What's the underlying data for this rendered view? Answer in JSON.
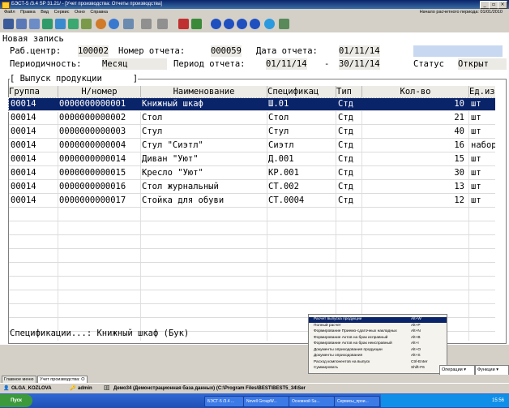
{
  "window": {
    "title": "БЭСТ-5 /3.4 SP 31.21/ - [Учет производства: Отчеты производства]",
    "minimize": "_",
    "restore": "▫",
    "close": "×"
  },
  "menu": {
    "items": [
      "Файл",
      "Правка",
      "Вид",
      "Сервис",
      "Окно",
      "Справка"
    ],
    "period_info": "Начало расчетного периода: 01/01/2010"
  },
  "form": {
    "title": "Новая запись",
    "work_center_label": "Раб.центр:",
    "work_center_value": "100002",
    "report_no_label": "Номер отчета:",
    "report_no_value": "000059",
    "report_date_label": "Дата отчета:",
    "report_date_value": "01/11/14",
    "periodicity_label": "Периодичность:",
    "periodicity_value": "Месяц",
    "period_label": "Период отчета:",
    "period_from": "01/11/14",
    "period_sep": "-",
    "period_to": "30/11/14",
    "status_label": "Статус",
    "status_value": "Открыт",
    "section_title": "[ Выпуск продукции      ]",
    "footer_spec": "Спецификации...: Книжный шкаф (Бук)"
  },
  "grid": {
    "columns": [
      "Группа",
      "Н/номер",
      "Наименование",
      "Спецификац",
      "Тип",
      "Кол-во",
      "Ед.из"
    ],
    "rows": [
      {
        "group": "00014",
        "number": "0000000000001",
        "name": "Книжный шкаф",
        "spec": "Ш.01",
        "type": "Стд",
        "qty": "10",
        "unit": "шт"
      },
      {
        "group": "00014",
        "number": "0000000000002",
        "name": "Стол",
        "spec": "Стол",
        "type": "Стд",
        "qty": "21",
        "unit": "шт"
      },
      {
        "group": "00014",
        "number": "0000000000003",
        "name": "Стул",
        "spec": "Стул",
        "type": "Стд",
        "qty": "40",
        "unit": "шт"
      },
      {
        "group": "00014",
        "number": "0000000000004",
        "name": "Стул \"Сиэтл\"",
        "spec": "Сиэтл",
        "type": "Стд",
        "qty": "16",
        "unit": "набор"
      },
      {
        "group": "00014",
        "number": "0000000000014",
        "name": "Диван \"Уют\"",
        "spec": "Д.001",
        "type": "Стд",
        "qty": "15",
        "unit": "шт"
      },
      {
        "group": "00014",
        "number": "0000000000015",
        "name": "Кресло \"Уют\"",
        "spec": "КР.001",
        "type": "Стд",
        "qty": "30",
        "unit": "шт"
      },
      {
        "group": "00014",
        "number": "0000000000016",
        "name": "Стол журнальный",
        "spec": "СТ.002",
        "type": "Стд",
        "qty": "13",
        "unit": "шт"
      },
      {
        "group": "00014",
        "number": "0000000000017",
        "name": "Стойка для обуви",
        "spec": "СТ.0004",
        "type": "Стд",
        "qty": "12",
        "unit": "шт"
      }
    ]
  },
  "popup_menu": {
    "items": [
      {
        "label": "Расчет выпуска продукции",
        "key": "Alt+W"
      },
      {
        "label": "Полный расчет",
        "key": "Alt+P"
      },
      {
        "label": "Формирование Приемо-сдаточных накладных",
        "key": "Alt+N"
      },
      {
        "label": "Формирование Актов на брак исправный",
        "key": "Alt+B"
      },
      {
        "label": "Формирование Актов на брак неисправный",
        "key": "Alt+I"
      },
      {
        "label": "Документы оприходования продукции",
        "key": "Alt+O"
      },
      {
        "label": "Документы оприходования",
        "key": "Alt+S"
      },
      {
        "label": "Расход компонентов на выпуск",
        "key": "Ctrl-Enter"
      },
      {
        "label": "Суммировать",
        "key": "Shift-F6"
      }
    ]
  },
  "tabs": [
    "Главное меню",
    "Учет производства: О"
  ],
  "dropdowns": {
    "operations": "Операции",
    "functions": "Функции"
  },
  "status": {
    "user": "OLGA_KOZLOVA",
    "role": "admin",
    "db": "Демо34 (Демонстрационная база данных) (C:\\Program Files\\BEST\\BEST5_34\\Ser"
  },
  "taskbar": {
    "start": "Пуск",
    "tasks": [
      "БЭСТ-5 /3.4 ...",
      "Novell GroupW...",
      "Основной Su...",
      "Сервисы_прои..."
    ],
    "clock": "15:56"
  },
  "colors": {
    "selection": "#0a246a",
    "titlebar": "#0a246a",
    "taskbar": "#3168d5"
  }
}
